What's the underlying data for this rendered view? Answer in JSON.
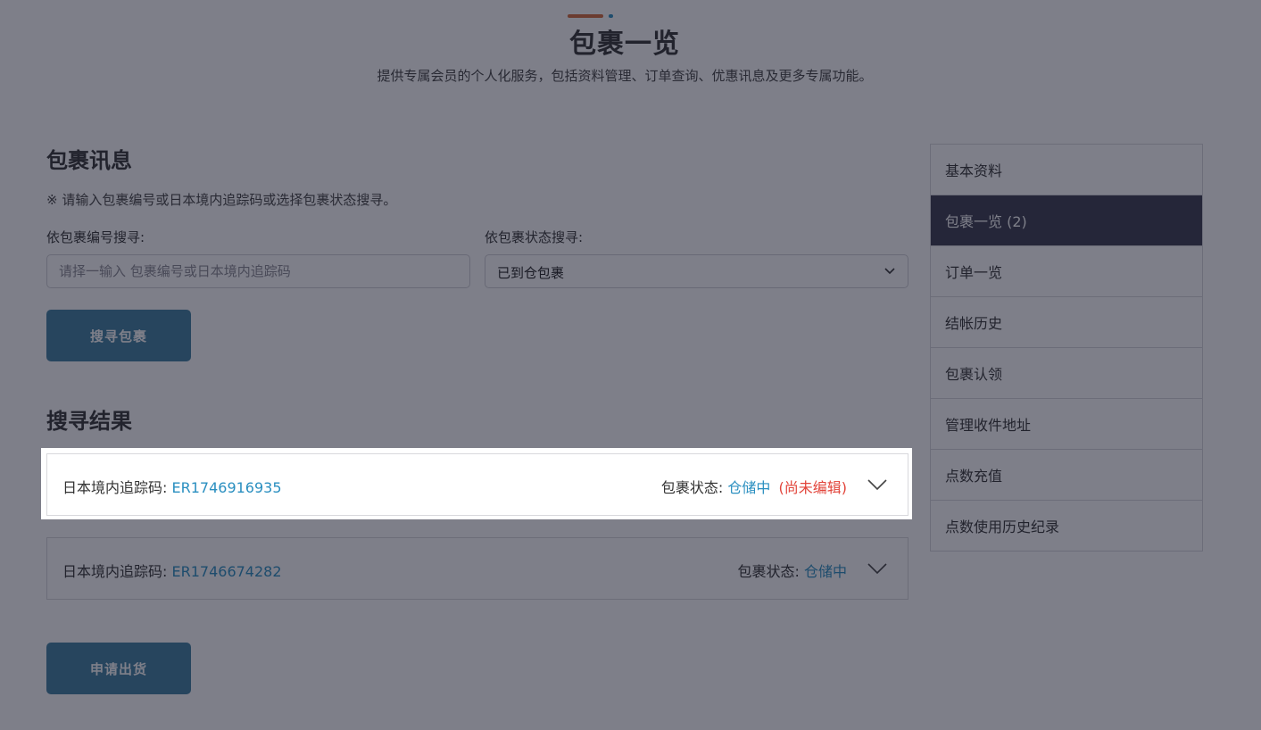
{
  "colors": {
    "accent": "#2a8fc0",
    "alert": "#e2443a",
    "button": "#3f7fa1",
    "deco_primary": "#d46a3a",
    "deco_secondary": "#2a8fc0",
    "sidebar_active": "#3a3b4e"
  },
  "header": {
    "title": "包裹一览",
    "subtitle": "提供专属会员的个人化服务，包括资料管理、订单查询、优惠讯息及更多专属功能。"
  },
  "search": {
    "section_title": "包裹讯息",
    "hint": "※ 请输入包裹编号或日本境内追踪码或选择包裹状态搜寻。",
    "by_number_label": "依包裹编号搜寻:",
    "by_number_placeholder": "请择一输入 包裹编号或日本境内追踪码",
    "by_status_label": "依包裹状态搜寻:",
    "by_status_selected": "已到仓包裹",
    "submit_label": "搜寻包裹"
  },
  "results": {
    "section_title": "搜寻结果",
    "tracking_label": "日本境内追踪码:",
    "status_label": "包裹状态:",
    "rows": [
      {
        "tracking_code": "ER1746916935",
        "status": "仓储中",
        "note": "(尚未编辑)"
      },
      {
        "tracking_code": "ER1746674282",
        "status": "仓储中",
        "note": ""
      }
    ],
    "ship_button_label": "申请出货"
  },
  "sidebar": {
    "items": [
      {
        "label": "基本资料"
      },
      {
        "label": "包裹一览 (2)"
      },
      {
        "label": "订单一览"
      },
      {
        "label": "结帐历史"
      },
      {
        "label": "包裹认领"
      },
      {
        "label": "管理收件地址"
      },
      {
        "label": "点数充值"
      },
      {
        "label": "点数使用历史纪录"
      }
    ],
    "active_index": 1
  }
}
